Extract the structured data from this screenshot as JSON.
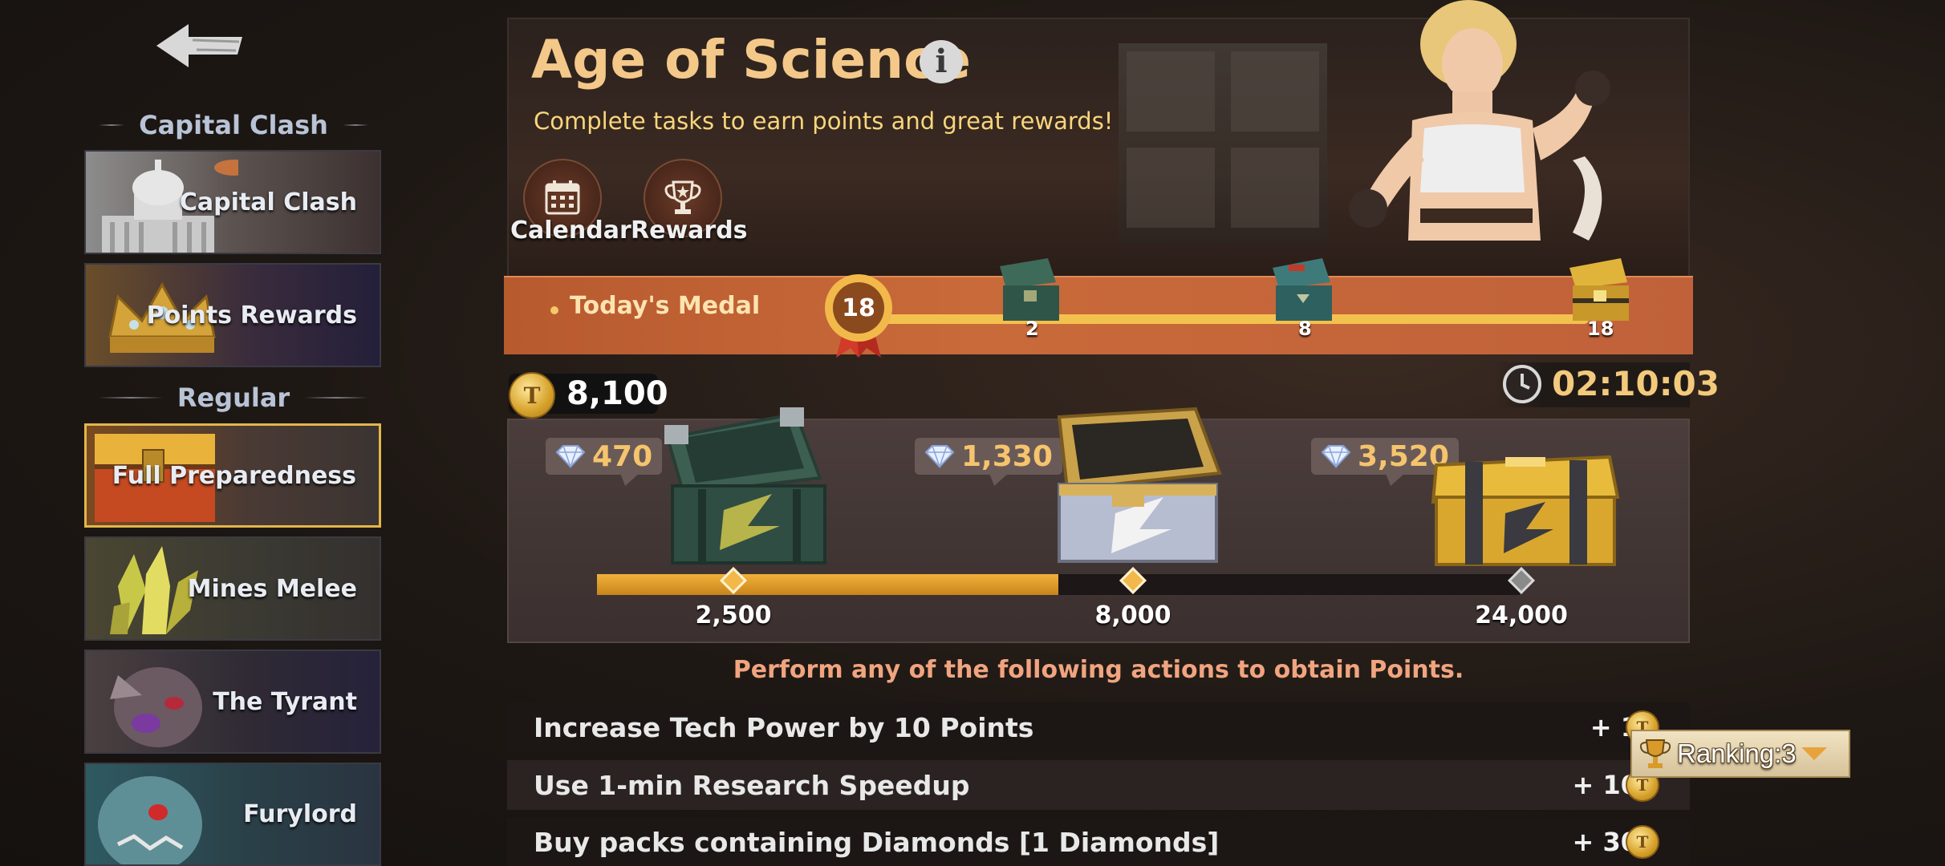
{
  "sidebar": {
    "sections": [
      {
        "title": "Capital Clash",
        "items": [
          {
            "label": "Capital Clash"
          },
          {
            "label": "Points Rewards"
          }
        ]
      },
      {
        "title": "Regular",
        "items": [
          {
            "label": "Full Preparedness",
            "active": true
          },
          {
            "label": "Mines Melee"
          },
          {
            "label": "The Tyrant"
          },
          {
            "label": "Furylord"
          }
        ]
      }
    ]
  },
  "header": {
    "title": "Age of Science",
    "subtitle": "Complete tasks to earn points and great rewards!",
    "buttons": [
      {
        "label": "Calendar",
        "icon": "calendar-icon"
      },
      {
        "label": "Rewards",
        "icon": "trophy-icon"
      }
    ]
  },
  "medal_track": {
    "label": "Today's Medal",
    "current": "18",
    "milestones": [
      "2",
      "8",
      "18"
    ]
  },
  "points": {
    "value": "8,100",
    "timer": "02:10:03"
  },
  "reward_chests": [
    {
      "price": "470",
      "threshold": "2,500",
      "color": "green"
    },
    {
      "price": "1,330",
      "threshold": "8,000",
      "color": "silver"
    },
    {
      "price": "3,520",
      "threshold": "24,000",
      "color": "gold"
    }
  ],
  "progress": {
    "current": 8100,
    "fraction_filled": 0.5
  },
  "instructions": "Perform any of the following actions to obtain Points.",
  "tasks": [
    {
      "name": "Increase Tech Power by 10 Points",
      "points": "+ 1"
    },
    {
      "name": "Use 1-min Research Speedup",
      "points": "+ 10"
    },
    {
      "name": "Buy packs containing Diamonds [1 Diamonds]",
      "points": "+ 30"
    }
  ],
  "ranking": {
    "label": "Ranking:3"
  },
  "colors": {
    "accent_gold": "#f3c889",
    "strip": "#c0613a",
    "price": "#f5c46d",
    "instr": "#f0a47f"
  }
}
